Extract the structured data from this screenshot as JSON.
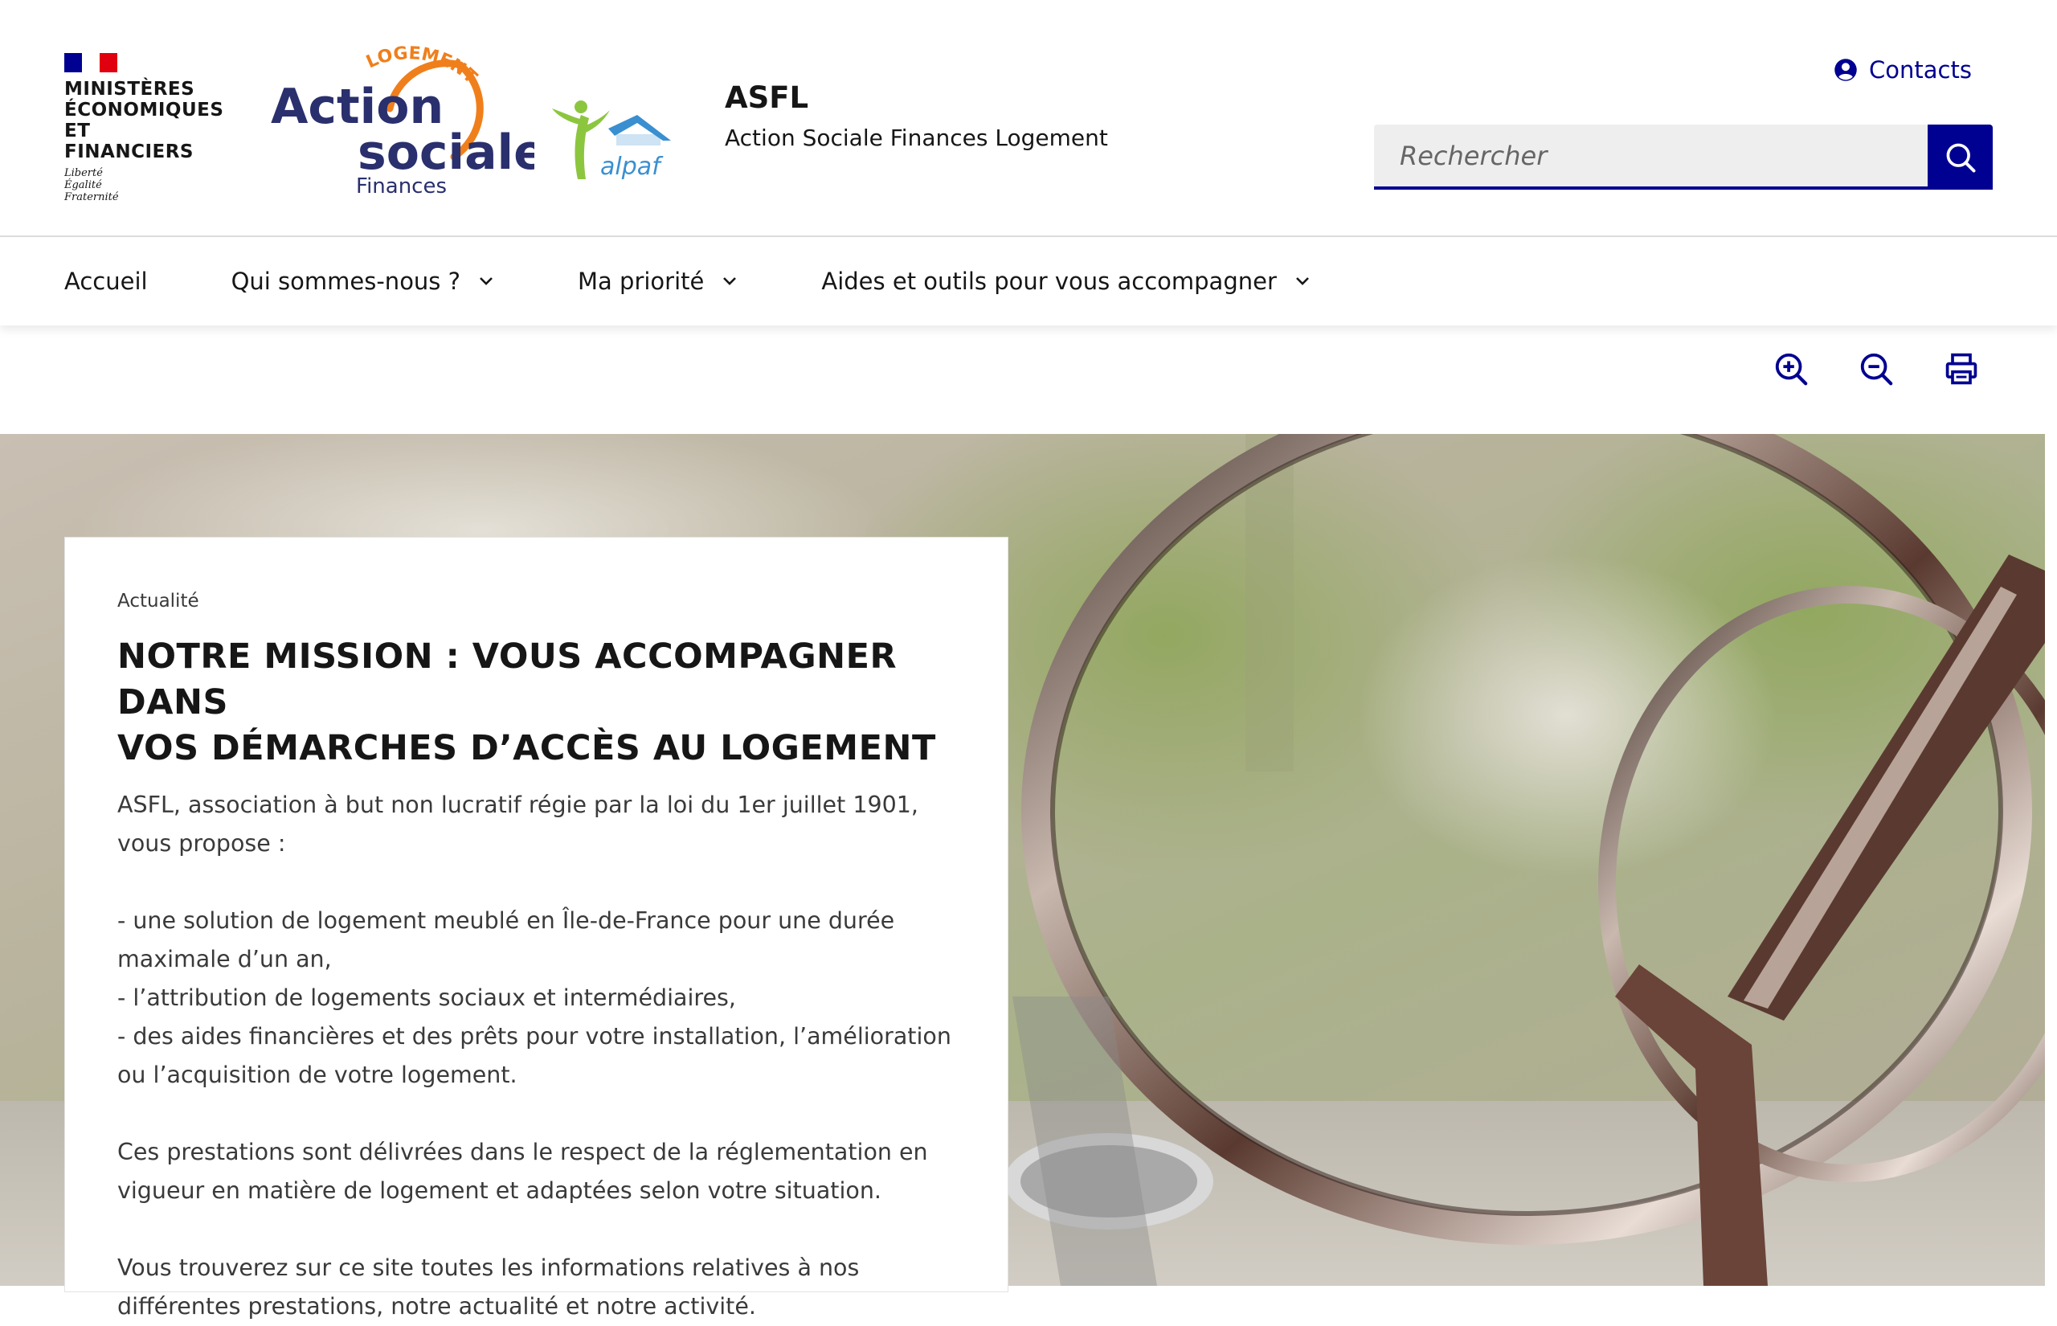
{
  "header": {
    "ministry_lines": [
      "MINISTÈRES",
      "ÉCONOMIQUES",
      "ET FINANCIERS"
    ],
    "devise_lines": [
      "Liberté",
      "Égalité",
      "Fraternité"
    ],
    "logo_asf": {
      "top": "LOGEMENT",
      "line1": "Action",
      "line2": "sociale",
      "line3": "Finances"
    },
    "logo_alpaf": "alpaf",
    "site_title": "ASFL",
    "site_tagline": "Action Sociale Finances Logement",
    "contacts_label": "Contacts",
    "search_placeholder": "Rechercher"
  },
  "nav": {
    "items": [
      {
        "label": "Accueil",
        "has_dropdown": false
      },
      {
        "label": "Qui sommes-nous ?",
        "has_dropdown": true
      },
      {
        "label": "Ma priorité",
        "has_dropdown": true
      },
      {
        "label": "Aides et outils pour vous accompagner",
        "has_dropdown": true
      }
    ]
  },
  "tools": {
    "icons": [
      "zoom-in-icon",
      "zoom-out-icon",
      "print-icon"
    ]
  },
  "card": {
    "tag": "Actualité",
    "title_lines": [
      "NOTRE MISSION : VOUS ACCOMPAGNER DANS",
      "VOS DÉMARCHES D’ACCÈS AU LOGEMENT"
    ],
    "intro": "ASFL, association à but non lucratif régie par la loi du 1er juillet 1901, vous propose :",
    "list": [
      "- une solution de logement meublé en Île-de-France pour une durée maximale d’un an,",
      "- l’attribution de logements sociaux et intermédiaires,",
      "- des aides financières et des prêts pour votre installation, l’amélioration ou l’acquisition de votre logement."
    ],
    "para2": "Ces prestations sont délivrées dans le respect de la réglementation en vigueur en matière de logement et adaptées selon votre situation.",
    "para3": "Vous trouverez sur ce site toutes les informations relatives à nos différentes prestations, notre actualité et notre activité."
  },
  "colors": {
    "brand_blue": "#000091",
    "marianne_red": "#e1000f",
    "logo_orange": "#f07f1b",
    "logo_navy": "#2a2f6d",
    "alpaf_green": "#8cc63f",
    "alpaf_blue": "#3a8fd0"
  }
}
